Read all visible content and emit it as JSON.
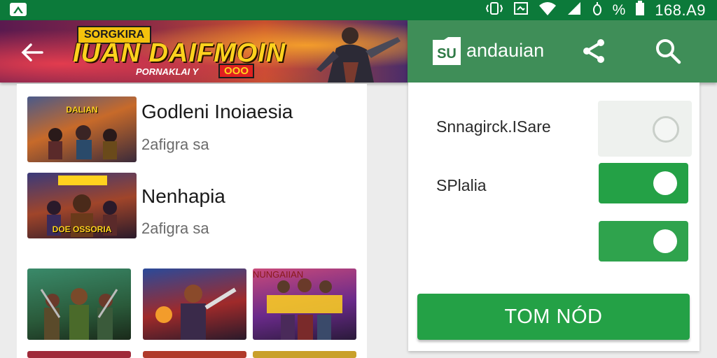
{
  "status_bar": {
    "clock": "168.A9",
    "battery_text": "%",
    "icons": [
      "app-indicator-icon",
      "vibrate-icon",
      "screenshot-icon",
      "wifi-icon",
      "signal-icon",
      "alarm-icon",
      "battery-icon"
    ]
  },
  "banner": {
    "logo_top": "SORGKIRA",
    "logo_main": "IUAN DAIFMOIN",
    "logo_sub": "PORNAKLAI Y",
    "logo_badge": "OOO"
  },
  "games": [
    {
      "title": "Godleni Inoiaesia",
      "subtitle": "2afigra sa",
      "thumb_label": "DALIAN"
    },
    {
      "title": "Nenhapia",
      "subtitle": "2afigra sa",
      "thumb_label": "DOE OSSORIA"
    }
  ],
  "grid": [
    {
      "label": ""
    },
    {
      "label": ""
    },
    {
      "label": "NUNGAIIAN"
    }
  ],
  "appbar": {
    "brand_mark": "SU",
    "brand": "andauian"
  },
  "settings": {
    "items": [
      {
        "label": "Snnagirck.ISare",
        "enabled": false
      },
      {
        "label": "SPlalia",
        "enabled": true
      },
      {
        "label": "",
        "enabled": true
      }
    ],
    "cta": "TOM NÓD"
  },
  "colors": {
    "status_bar": "#0c7a3a",
    "appbar": "#3f8e58",
    "accent": "#24a146"
  }
}
